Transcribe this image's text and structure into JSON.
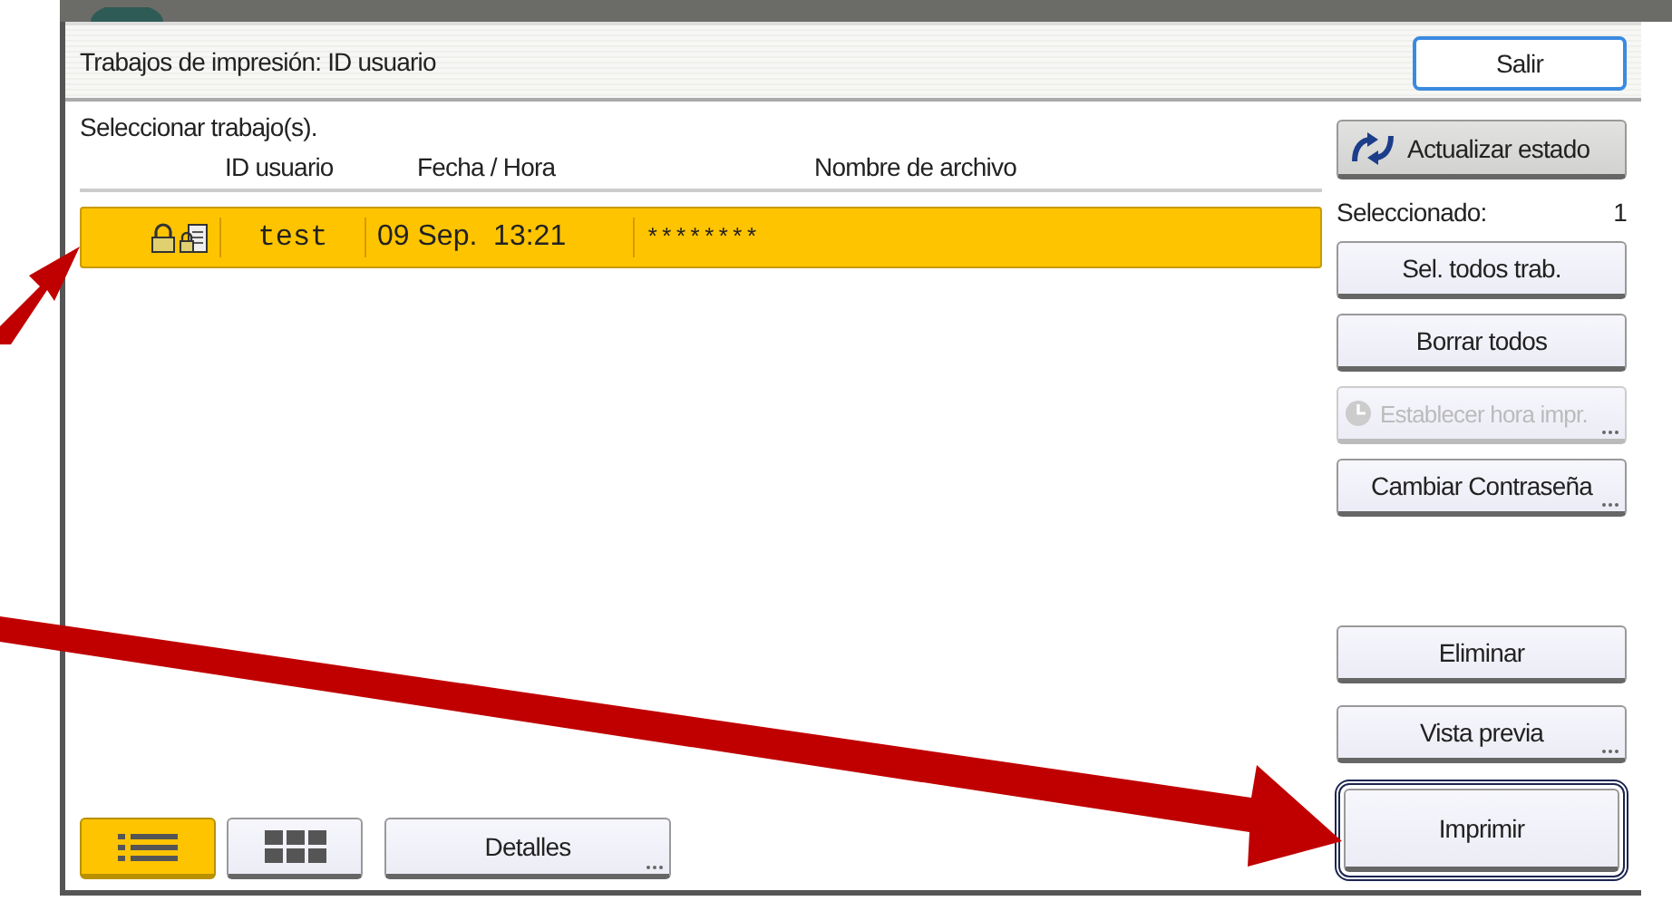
{
  "window": {
    "title": "Trabajos de impresión: ID usuario",
    "exit_button": "Salir"
  },
  "instruction": "Seleccionar trabajo(s).",
  "columns": [
    "ID usuario",
    "Fecha / Hora",
    "Nombre de archivo"
  ],
  "rows": [
    {
      "locked": true,
      "user_id": "test",
      "datetime": "09 Sep.  13:21",
      "filename": "********",
      "selected": true
    }
  ],
  "sidebar": {
    "refresh_button": "Actualizar estado",
    "selected_label": "Seleccionado:",
    "selected_count": "1",
    "top_buttons": [
      {
        "label": "Sel. todos trab.",
        "disabled": false,
        "more": false,
        "focused": false
      },
      {
        "label": "Borrar todos",
        "disabled": false,
        "more": false,
        "focused": false
      },
      {
        "label": "Establecer hora impr.",
        "disabled": true,
        "more": true,
        "focused": false,
        "kind": "clock"
      },
      {
        "label": "Cambiar Contraseña",
        "disabled": false,
        "more": true,
        "focused": false
      }
    ],
    "bottom_buttons": [
      {
        "label": "Eliminar",
        "disabled": false,
        "more": false,
        "focused": false
      },
      {
        "label": "Vista previa",
        "disabled": false,
        "more": true,
        "focused": false
      },
      {
        "label": "Imprimir",
        "disabled": false,
        "more": false,
        "focused": true
      }
    ]
  },
  "view_toggles": [
    {
      "kind": "list",
      "selected": true
    },
    {
      "kind": "grid",
      "selected": false
    }
  ],
  "details_button": {
    "label": "Detalles",
    "more": true
  }
}
